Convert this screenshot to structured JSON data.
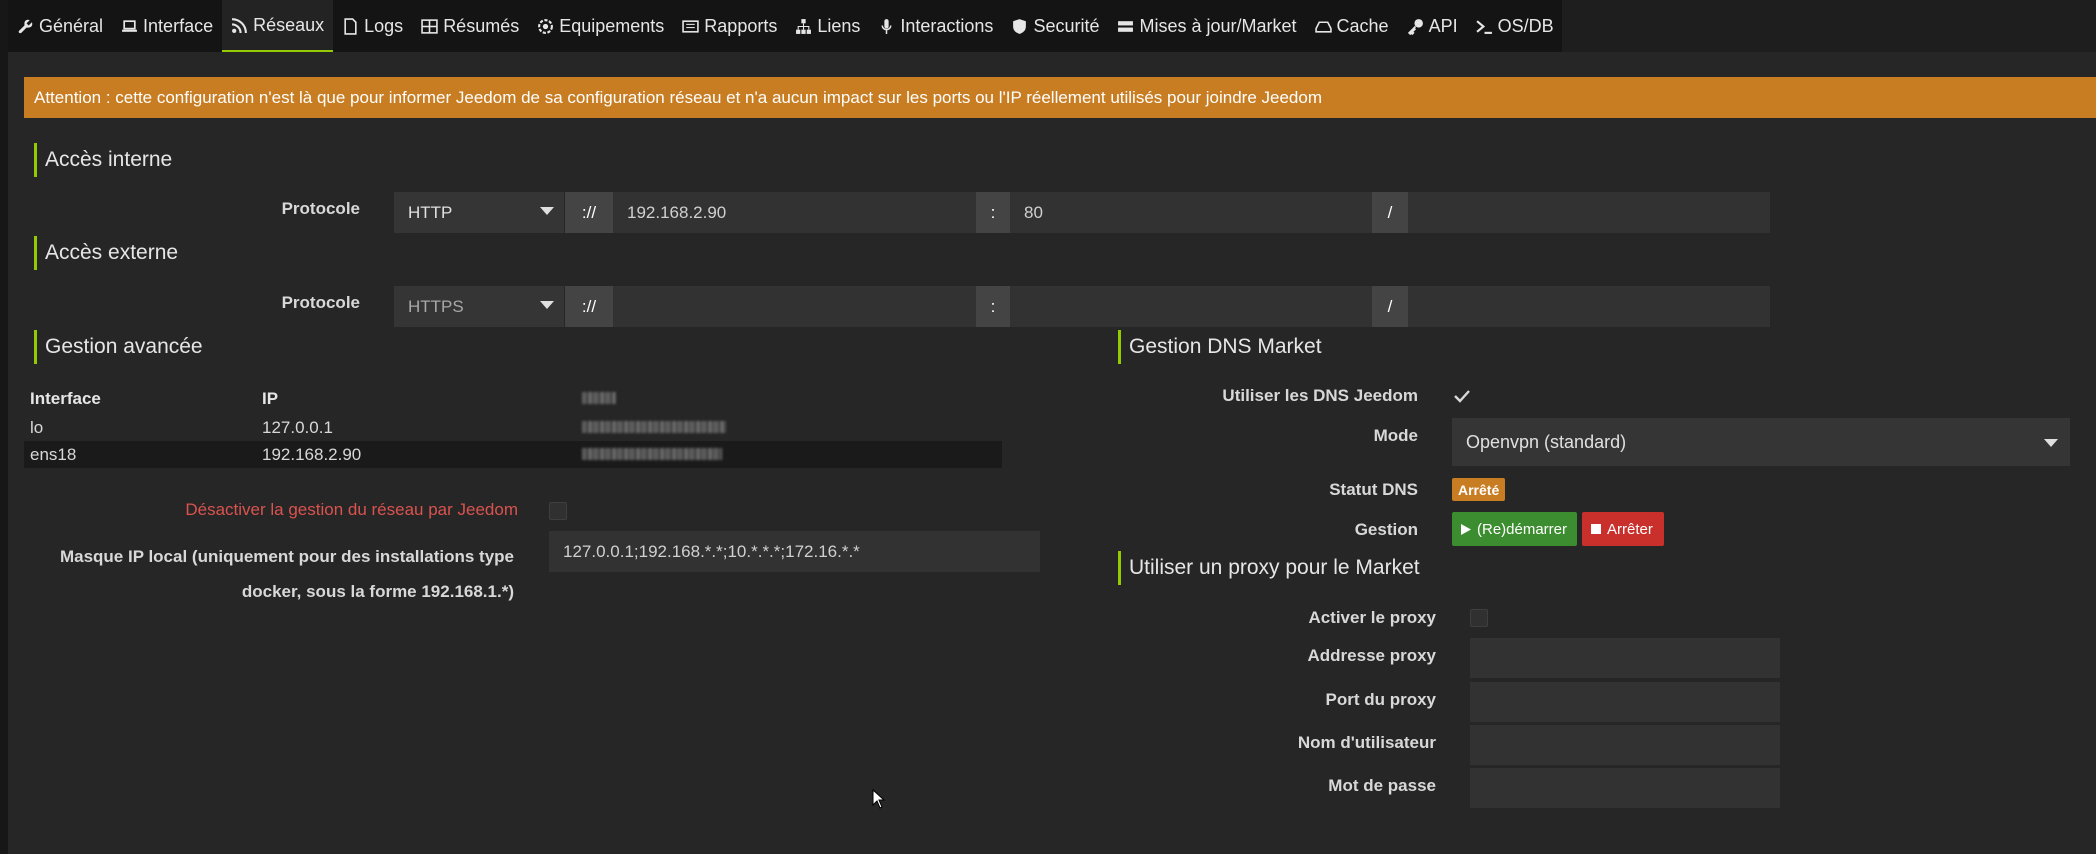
{
  "tabs": [
    {
      "label": "Général",
      "icon": "wrench-icon"
    },
    {
      "label": "Interface",
      "icon": "laptop-icon"
    },
    {
      "label": "Réseaux",
      "icon": "rss-icon",
      "active": true
    },
    {
      "label": "Logs",
      "icon": "file-icon"
    },
    {
      "label": "Résumés",
      "icon": "table-icon"
    },
    {
      "label": "Equipements",
      "icon": "cog-icon"
    },
    {
      "label": "Rapports",
      "icon": "newspaper-icon"
    },
    {
      "label": "Liens",
      "icon": "sitemap-icon"
    },
    {
      "label": "Interactions",
      "icon": "microphone-icon"
    },
    {
      "label": "Securité",
      "icon": "shield-icon"
    },
    {
      "label": "Mises à jour/Market",
      "icon": "server-icon"
    },
    {
      "label": "Cache",
      "icon": "hdd-icon"
    },
    {
      "label": "API",
      "icon": "key-icon"
    },
    {
      "label": "OS/DB",
      "icon": "terminal-icon"
    }
  ],
  "alert": "Attention : cette configuration n'est là que pour informer Jeedom de sa configuration réseau et n'a aucun impact sur les ports ou l'IP réellement utilisés pour joindre Jeedom",
  "internal": {
    "title": "Accès interne",
    "protocol_label": "Protocole",
    "protocol": "HTTP",
    "sep_scheme": "://",
    "host": "192.168.2.90",
    "sep_port": ":",
    "port": "80",
    "sep_path": "/",
    "path": ""
  },
  "external": {
    "title": "Accès externe",
    "protocol_label": "Protocole",
    "protocol": "HTTPS",
    "sep_scheme": "://",
    "host": "",
    "sep_port": ":",
    "port": "",
    "sep_path": "/",
    "path": ""
  },
  "advanced": {
    "title": "Gestion avancée",
    "columns": [
      "Interface",
      "IP",
      ""
    ],
    "rows": [
      {
        "interface": "lo",
        "ip": "127.0.0.1"
      },
      {
        "interface": "ens18",
        "ip": "192.168.2.90"
      }
    ],
    "disable_label": "Désactiver la gestion du réseau par Jeedom",
    "mask_label_line1": "Masque IP local (uniquement pour des installations type",
    "mask_label_line2": "docker, sous la forme 192.168.1.*)",
    "mask_value": "127.0.0.1;192.168.*.*;10.*.*.*;172.16.*.*"
  },
  "dns": {
    "title": "Gestion DNS Market",
    "use_label": "Utiliser les DNS Jeedom",
    "use_checked": true,
    "mode_label": "Mode",
    "mode_value": "Openvpn (standard)",
    "status_label": "Statut DNS",
    "status_value": "Arrêté",
    "status_color": "#c97d22",
    "manage_label": "Gestion",
    "restart_label": "(Re)démarrer",
    "stop_label": "Arrêter"
  },
  "proxy": {
    "title": "Utiliser un proxy pour le Market",
    "enable_label": "Activer le proxy",
    "address_label": "Addresse proxy",
    "port_label": "Port du proxy",
    "user_label": "Nom d'utilisateur",
    "password_label": "Mot de passe"
  },
  "colors": {
    "accent": "#94ca02",
    "alert_bg": "#c97d22",
    "danger_text": "#d9534f",
    "success": "#3c8d2f",
    "danger": "#c9302c"
  }
}
